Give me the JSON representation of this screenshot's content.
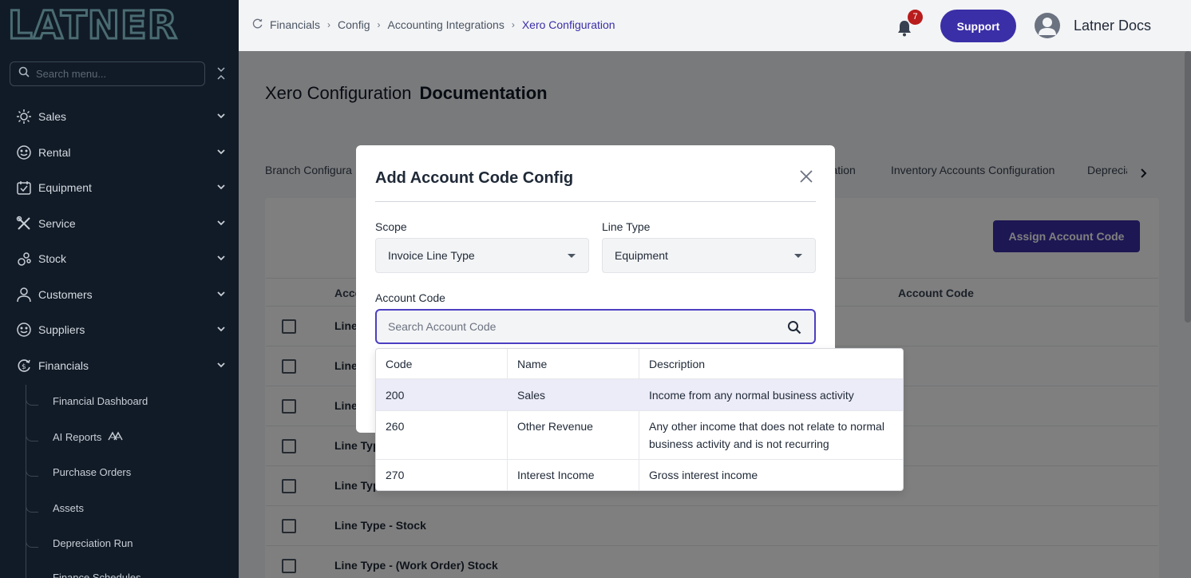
{
  "sidebar": {
    "logo": "LATNER",
    "search_placeholder": "Search menu...",
    "items": [
      {
        "label": "Sales",
        "icon": "sales-icon"
      },
      {
        "label": "Rental",
        "icon": "rental-icon"
      },
      {
        "label": "Equipment",
        "icon": "equipment-icon"
      },
      {
        "label": "Service",
        "icon": "service-icon"
      },
      {
        "label": "Stock",
        "icon": "stock-icon"
      },
      {
        "label": "Customers",
        "icon": "person-icon"
      },
      {
        "label": "Suppliers",
        "icon": "suppliers-icon"
      },
      {
        "label": "Financials",
        "icon": "financials-icon"
      }
    ],
    "financials_sub": [
      "Financial Dashboard",
      "AI Reports",
      "Purchase Orders",
      "Assets",
      "Depreciation Run",
      "Finance Schedules"
    ]
  },
  "header": {
    "breadcrumbs": [
      "Financials",
      "Config",
      "Accounting Integrations",
      "Xero Configuration"
    ],
    "notification_count": "7",
    "support_label": "Support",
    "user_name": "Latner Docs"
  },
  "main": {
    "title": "Xero Configuration",
    "title_link": "Documentation",
    "tabs": [
      "Branch Configura",
      "uration",
      "Inventory Accounts Configuration",
      "Depreciation I"
    ],
    "assign_button": "Assign Account Code",
    "columns": [
      "Acco",
      "Account Code"
    ],
    "rows": [
      "Line",
      "Line",
      "Line",
      "Line Typ",
      "Line Typ",
      "Line Type - Stock",
      "Line Type - (Work Order) Stock"
    ]
  },
  "modal": {
    "title": "Add Account Code Config",
    "scope_label": "Scope",
    "scope_value": "Invoice Line Type",
    "line_type_label": "Line Type",
    "line_type_value": "Equipment",
    "account_code_label": "Account Code",
    "search_placeholder": "Search Account Code",
    "dropdown": {
      "headers": [
        "Code",
        "Name",
        "Description"
      ],
      "rows": [
        {
          "code": "200",
          "name": "Sales",
          "description": "Income from any normal business activity"
        },
        {
          "code": "260",
          "name": "Other Revenue",
          "description": "Any other income that does not relate to normal business activity and is not recurring"
        },
        {
          "code": "270",
          "name": "Interest Income",
          "description": "Gross interest income"
        }
      ]
    }
  },
  "colors": {
    "accent": "#3b2fa7",
    "sidebar_bg": "#111b27",
    "badge": "#b91c1c"
  }
}
